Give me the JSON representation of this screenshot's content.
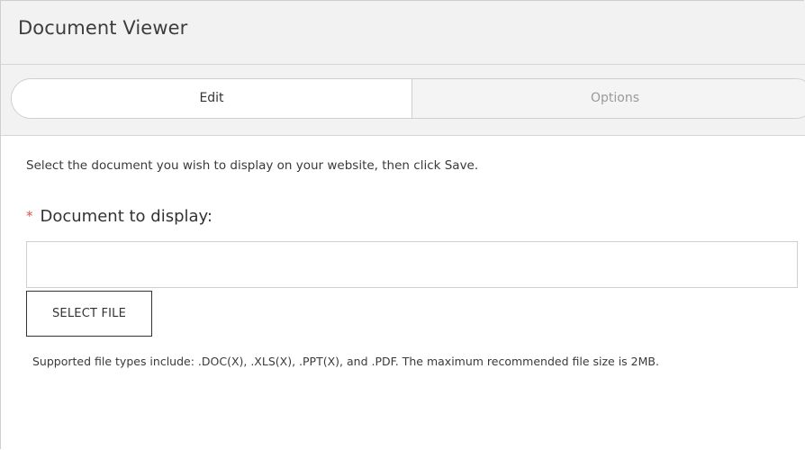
{
  "header": {
    "title": "Document Viewer"
  },
  "tabs": [
    {
      "label": "Edit",
      "active": true
    },
    {
      "label": "Options",
      "active": false
    }
  ],
  "content": {
    "instruction": "Select the document you wish to display on your website, then click Save.",
    "field": {
      "required_marker": "*",
      "label": "Document to display:",
      "value": "",
      "placeholder": ""
    },
    "select_file_label": "SELECT FILE",
    "supported_note": "Supported file types include: .DOC(X), .XLS(X), .PPT(X), and .PDF. The maximum recommended file size is 2MB."
  },
  "colors": {
    "header_bg": "#f2f2f2",
    "border": "#cfcfcf",
    "required": "#d9534f",
    "inactive_tab_text": "#9a9a9a"
  }
}
